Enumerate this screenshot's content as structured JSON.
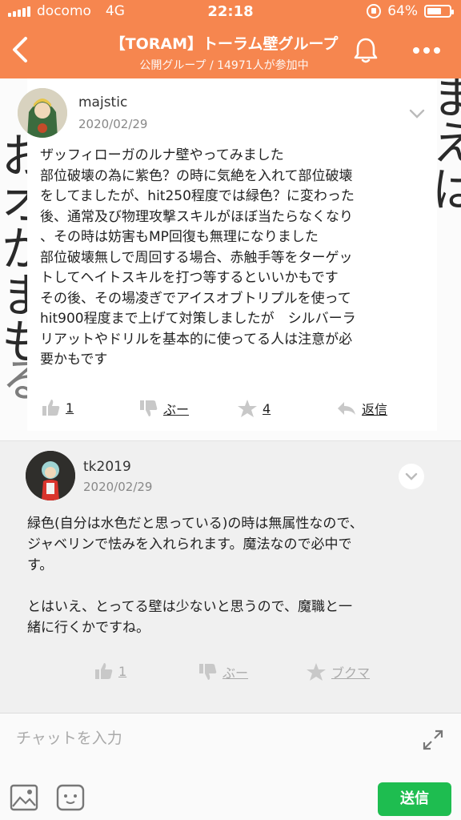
{
  "status": {
    "carrier": "docomo",
    "network": "4G",
    "time": "22:18",
    "battery": "64%",
    "battery_level": 0.64
  },
  "header": {
    "title": "【TORAM】トーラム壁グループ",
    "subtitle": "公開グループ / 14971人が参加中",
    "bar_color": "#f6864f"
  },
  "post1": {
    "author": "majstic",
    "date": "2020/02/29",
    "lines": [
      "ザッフィローガのルナ壁やってみました",
      "部位破壊の為に紫色？の時に気絶を入れて部位破壊",
      "をしてましたが、hit250程度では緑色？に変わった",
      "後、通常及び物理攻撃スキルがほぼ当たらなくなり",
      "、その時は妨害もMP回復も無理になりました",
      "部位破壊無しで周回する場合、赤触手等をターゲッ",
      "トしてヘイトスキルを打つ等するといいかもです",
      "その後、その場凌ぎでアイスオブトリプルを使って",
      "hit900程度まで上げて対策しましたが　シルバーラ",
      "リアットやドリルを基本的に使ってる人は注意が必",
      "要かもです"
    ],
    "like_count": "1",
    "boo_label": "ぶー",
    "star_count": "4",
    "reply_label": "返信"
  },
  "post2": {
    "author": "tk2019",
    "date": "2020/02/29",
    "lines": [
      "緑色(自分は水色だと思っている)の時は無属性なので、",
      "ジャベリンで怯みを入れられます。魔法なので必中で",
      "す。",
      "",
      "とはいえ、とってる壁は少ないと思うので、魔職と一",
      "緒に行くかですね。"
    ],
    "like_count": "1",
    "boo_label": "ぶー",
    "bookmark_label": "ブクマ"
  },
  "composer": {
    "placeholder": "チャットを入力",
    "send_label": "送信",
    "send_color": "#1ebd50"
  },
  "background": {
    "left_chars": [
      "お",
      "オ",
      "か",
      "ま",
      "も",
      "る"
    ],
    "right_chars": [
      "ま",
      "え",
      "は"
    ]
  }
}
